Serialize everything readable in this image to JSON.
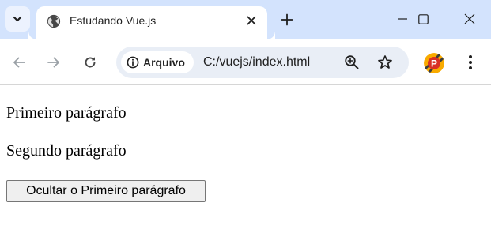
{
  "browser": {
    "tab": {
      "title": "Estudando Vue.js",
      "favicon": "globe-icon"
    },
    "toolbar": {
      "security_chip_label": "Arquivo",
      "url": "C:/vuejs/index.html",
      "profile_initial": "P"
    },
    "icons": {
      "tab_search": "chevron-down-icon",
      "close_tab": "close-icon",
      "new_tab": "plus-icon",
      "minimize": "minimize-icon",
      "maximize": "maximize-icon",
      "close_window": "close-icon",
      "back": "arrow-left-icon",
      "forward": "arrow-right-icon",
      "reload": "reload-icon",
      "info": "info-icon",
      "zoom": "zoom-in-icon",
      "bookmark": "star-icon",
      "menu": "kebab-menu-icon"
    },
    "colors": {
      "tabstrip_bg": "#d3e3fd",
      "omnibox_bg": "#e9eef6",
      "profile_red": "#d93025",
      "profile_yellow": "#f9ab00"
    }
  },
  "page": {
    "paragraph_1": "Primeiro parágrafo",
    "paragraph_2": "Segundo parágrafo",
    "toggle_button_label": "Ocultar o Primeiro parágrafo"
  }
}
